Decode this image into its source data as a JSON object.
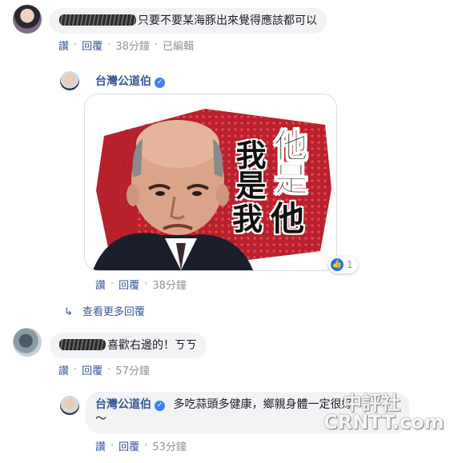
{
  "comment1": {
    "text": "只要不要某海豚出來覺得應該都可以",
    "like": "讚",
    "reply": "回覆",
    "time": "38分鐘",
    "edited": "已編輯"
  },
  "reply1": {
    "author": "台灣公道伯",
    "sticker": {
      "line1": "他是",
      "line2": "我是",
      "line3": "他",
      "line4": "我"
    },
    "reaction_count": "1",
    "like": "讚",
    "reply": "回覆",
    "time": "38分鐘"
  },
  "more_replies": "查看更多回覆",
  "comment2": {
    "text": "喜歡右邊的！ㄎㄎ",
    "like": "讚",
    "reply": "回覆",
    "time": "57分鐘"
  },
  "reply2": {
    "author": "台灣公道伯",
    "text": "多吃蒜頭多健康，鄉親身體一定很好",
    "text_tail": "～",
    "like": "讚",
    "reply": "回覆",
    "time": "53分鐘"
  },
  "watermark": {
    "top": "中評社",
    "bottom": "CRNTT.com"
  },
  "colors": {
    "link": "#385898",
    "meta": "#90949c",
    "bubble": "#f2f3f5",
    "sticker_red": "#b8202b"
  }
}
